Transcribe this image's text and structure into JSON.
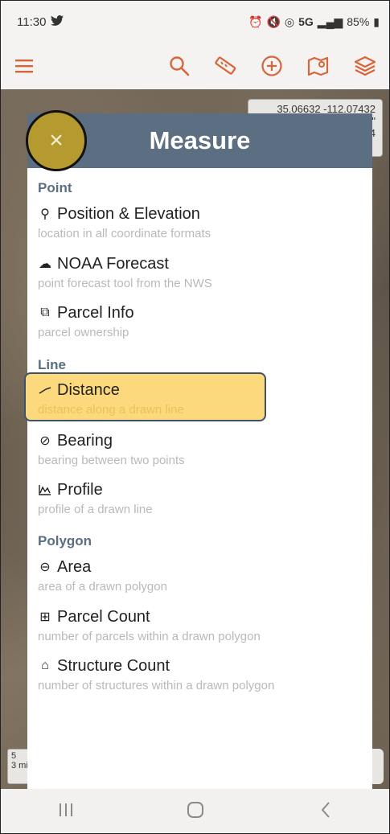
{
  "status": {
    "time": "11:30",
    "battery": "85%",
    "network": "5G"
  },
  "map": {
    "coord_line1": "35.06632 -112.07432",
    "coord_line2": "\"",
    "coord_line3": "4",
    "scale_top": "5",
    "scale_bottom": "3 mi"
  },
  "panel": {
    "title": "Measure",
    "close_label": "×",
    "sections": {
      "point": "Point",
      "line": "Line",
      "polygon": "Polygon"
    },
    "items": {
      "position": {
        "title": "Position & Elevation",
        "sub": "location in all coordinate formats"
      },
      "noaa": {
        "title": "NOAA Forecast",
        "sub": "point forecast tool from the NWS"
      },
      "parcel_info": {
        "title": "Parcel Info",
        "sub": "parcel ownership"
      },
      "distance": {
        "title": "Distance",
        "sub": "distance along a drawn line"
      },
      "bearing": {
        "title": "Bearing",
        "sub": "bearing between two points"
      },
      "profile": {
        "title": "Profile",
        "sub": "profile of a drawn line"
      },
      "area": {
        "title": "Area",
        "sub": "area of a drawn polygon"
      },
      "parcel_count": {
        "title": "Parcel Count",
        "sub": "number of parcels within a drawn polygon"
      },
      "structure_count": {
        "title": "Structure Count",
        "sub": "number of structures within a drawn polygon"
      }
    }
  },
  "icons": {
    "accent": "#d9643a",
    "header": "#5b6e82",
    "highlight": "#fcd97d"
  }
}
